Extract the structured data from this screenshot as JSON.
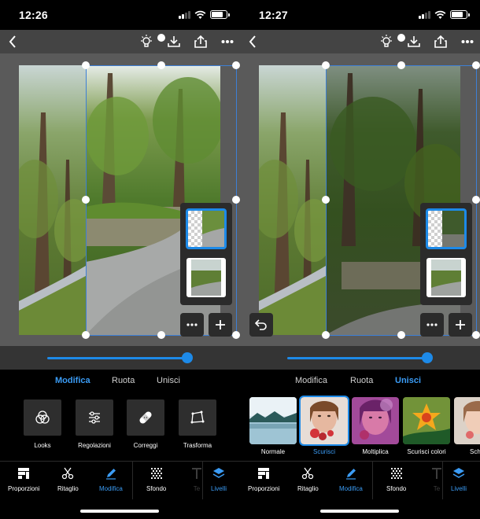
{
  "left": {
    "status": {
      "time": "12:26"
    },
    "tabs": [
      {
        "label": "Modifica"
      },
      {
        "label": "Ruota"
      },
      {
        "label": "Unisci"
      }
    ],
    "active_tab": "Modifica",
    "tools": [
      {
        "label": "Looks",
        "icon": "looks-icon"
      },
      {
        "label": "Regolazioni",
        "icon": "sliders-icon"
      },
      {
        "label": "Correggi",
        "icon": "bandage-icon"
      },
      {
        "label": "Trasforma",
        "icon": "transform-icon"
      }
    ],
    "nav": [
      {
        "label": "Proporzioni",
        "icon": "proportions-icon"
      },
      {
        "label": "Ritaglio",
        "icon": "scissors-icon"
      },
      {
        "label": "Modifica",
        "icon": "pencil-icon"
      },
      {
        "label": "Sfondo",
        "icon": "background-icon"
      },
      {
        "label": "Te",
        "icon": "text-icon"
      },
      {
        "label": "Livelli",
        "icon": "layers-icon"
      }
    ],
    "active_nav": "Modifica",
    "slider_value": 1.0
  },
  "right": {
    "status": {
      "time": "12:27"
    },
    "tabs": [
      {
        "label": "Modifica"
      },
      {
        "label": "Ruota"
      },
      {
        "label": "Unisci"
      }
    ],
    "active_tab": "Unisci",
    "blend_modes": [
      {
        "label": "Normale"
      },
      {
        "label": "Scurisci"
      },
      {
        "label": "Moltiplica"
      },
      {
        "label": "Scurisci colori"
      },
      {
        "label": "Schia"
      }
    ],
    "active_blend": "Scurisci",
    "nav": [
      {
        "label": "Proporzioni",
        "icon": "proportions-icon"
      },
      {
        "label": "Ritaglio",
        "icon": "scissors-icon"
      },
      {
        "label": "Modifica",
        "icon": "pencil-icon"
      },
      {
        "label": "Sfondo",
        "icon": "background-icon"
      },
      {
        "label": "Te",
        "icon": "text-icon"
      },
      {
        "label": "Livelli",
        "icon": "layers-icon"
      }
    ],
    "active_nav": "Livelli",
    "slider_value": 1.0
  },
  "colors": {
    "accent": "#1d8ae8",
    "accent_text": "#3b9cf5",
    "toolbar": "#444444",
    "canvas": "#5a5a5a"
  }
}
